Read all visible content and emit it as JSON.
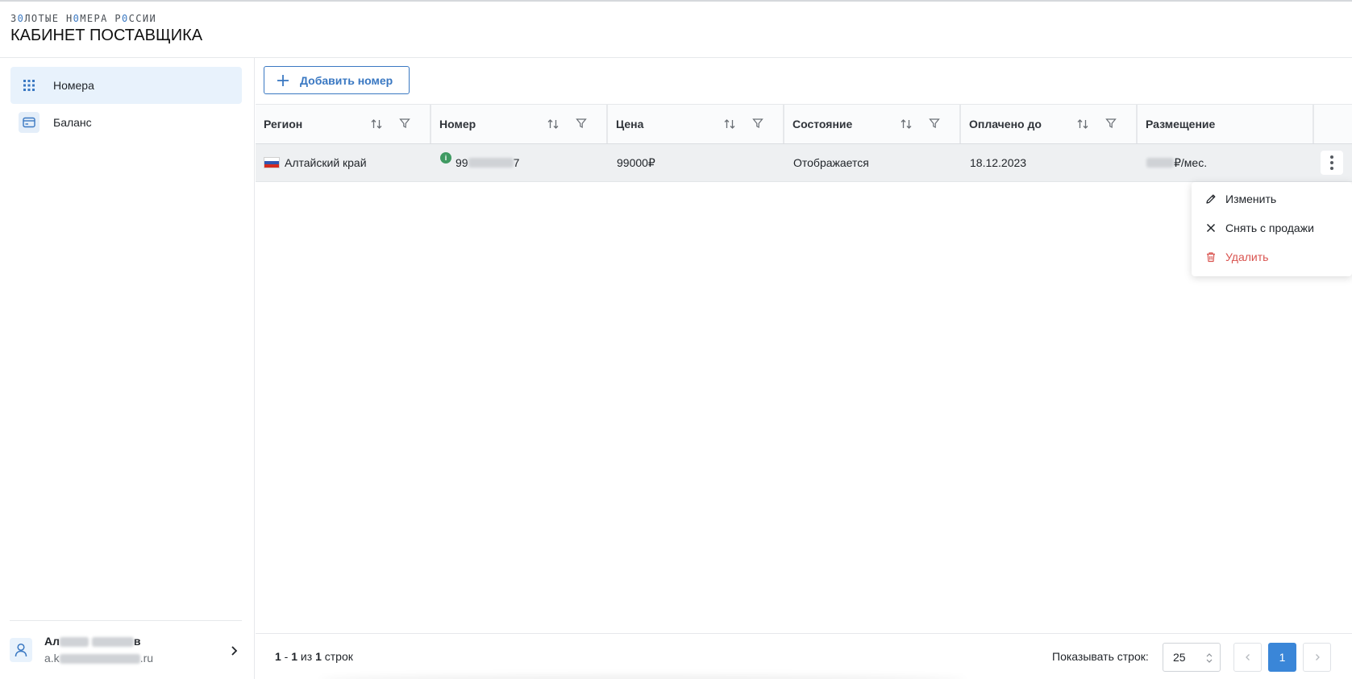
{
  "header": {
    "brand_part1": "З",
    "brand_accent1": "0",
    "brand_part2": "ЛОТЫЕ Н",
    "brand_accent2": "0",
    "brand_part3": "МЕРА Р",
    "brand_accent3": "0",
    "brand_part4": "ССИИ",
    "cabinet_title": "КАБИНЕТ ПОСТАВЩИКА"
  },
  "sidebar": {
    "items": [
      {
        "label": "Номера",
        "icon": "keypad-icon",
        "active": true
      },
      {
        "label": "Баланс",
        "icon": "card-icon",
        "active": false
      }
    ],
    "user": {
      "name_start": "Ал",
      "name_end": "в",
      "email_start": "a.k",
      "email_end": ".ru"
    }
  },
  "toolbar": {
    "add_label": "Добавить номер"
  },
  "table": {
    "columns": [
      {
        "label": "Регион"
      },
      {
        "label": "Номер"
      },
      {
        "label": "Цена"
      },
      {
        "label": "Состояние"
      },
      {
        "label": "Оплачено до"
      },
      {
        "label": "Размещение"
      }
    ],
    "rows": [
      {
        "region": "Алтайский край",
        "number_start": "99",
        "number_end": "7",
        "price": "99000₽",
        "state": "Отображается",
        "paid_until": "18.12.2023",
        "placement_suffix": "₽/мес."
      }
    ]
  },
  "row_menu": {
    "items": [
      {
        "label": "Изменить",
        "icon": "pencil-icon"
      },
      {
        "label": "Снять с продажи",
        "icon": "close-icon"
      },
      {
        "label": "Удалить",
        "icon": "trash-icon"
      }
    ]
  },
  "footer": {
    "range_from": "1",
    "range_sep": " - ",
    "range_to": "1",
    "range_of": " из ",
    "range_total": "1",
    "range_unit": " строк",
    "rows_label": "Показывать строк:",
    "rows_value": "25",
    "current_page": "1"
  },
  "colors": {
    "accent": "#3a78c2",
    "active_nav_bg": "#e8f2fc",
    "danger": "#d9534f",
    "status_green": "#3f9a62"
  }
}
